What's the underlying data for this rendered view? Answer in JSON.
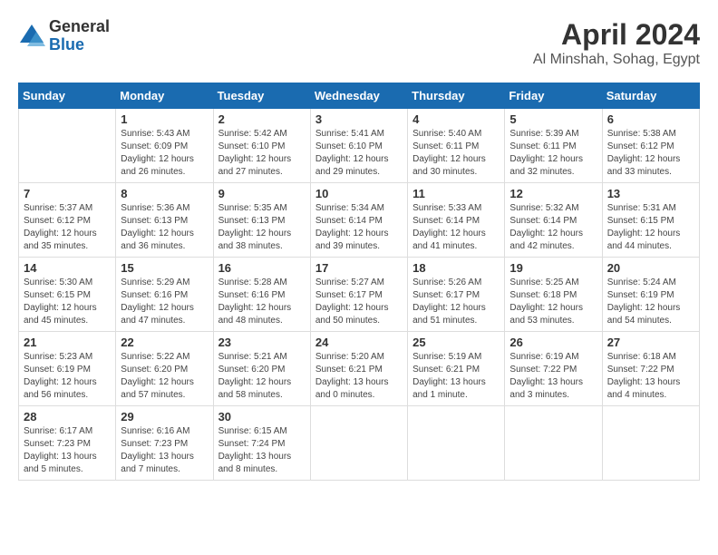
{
  "header": {
    "logo_general": "General",
    "logo_blue": "Blue",
    "month_title": "April 2024",
    "location": "Al Minshah, Sohag, Egypt"
  },
  "weekdays": [
    "Sunday",
    "Monday",
    "Tuesday",
    "Wednesday",
    "Thursday",
    "Friday",
    "Saturday"
  ],
  "weeks": [
    [
      {
        "day": "",
        "info": ""
      },
      {
        "day": "1",
        "info": "Sunrise: 5:43 AM\nSunset: 6:09 PM\nDaylight: 12 hours\nand 26 minutes."
      },
      {
        "day": "2",
        "info": "Sunrise: 5:42 AM\nSunset: 6:10 PM\nDaylight: 12 hours\nand 27 minutes."
      },
      {
        "day": "3",
        "info": "Sunrise: 5:41 AM\nSunset: 6:10 PM\nDaylight: 12 hours\nand 29 minutes."
      },
      {
        "day": "4",
        "info": "Sunrise: 5:40 AM\nSunset: 6:11 PM\nDaylight: 12 hours\nand 30 minutes."
      },
      {
        "day": "5",
        "info": "Sunrise: 5:39 AM\nSunset: 6:11 PM\nDaylight: 12 hours\nand 32 minutes."
      },
      {
        "day": "6",
        "info": "Sunrise: 5:38 AM\nSunset: 6:12 PM\nDaylight: 12 hours\nand 33 minutes."
      }
    ],
    [
      {
        "day": "7",
        "info": "Sunrise: 5:37 AM\nSunset: 6:12 PM\nDaylight: 12 hours\nand 35 minutes."
      },
      {
        "day": "8",
        "info": "Sunrise: 5:36 AM\nSunset: 6:13 PM\nDaylight: 12 hours\nand 36 minutes."
      },
      {
        "day": "9",
        "info": "Sunrise: 5:35 AM\nSunset: 6:13 PM\nDaylight: 12 hours\nand 38 minutes."
      },
      {
        "day": "10",
        "info": "Sunrise: 5:34 AM\nSunset: 6:14 PM\nDaylight: 12 hours\nand 39 minutes."
      },
      {
        "day": "11",
        "info": "Sunrise: 5:33 AM\nSunset: 6:14 PM\nDaylight: 12 hours\nand 41 minutes."
      },
      {
        "day": "12",
        "info": "Sunrise: 5:32 AM\nSunset: 6:14 PM\nDaylight: 12 hours\nand 42 minutes."
      },
      {
        "day": "13",
        "info": "Sunrise: 5:31 AM\nSunset: 6:15 PM\nDaylight: 12 hours\nand 44 minutes."
      }
    ],
    [
      {
        "day": "14",
        "info": "Sunrise: 5:30 AM\nSunset: 6:15 PM\nDaylight: 12 hours\nand 45 minutes."
      },
      {
        "day": "15",
        "info": "Sunrise: 5:29 AM\nSunset: 6:16 PM\nDaylight: 12 hours\nand 47 minutes."
      },
      {
        "day": "16",
        "info": "Sunrise: 5:28 AM\nSunset: 6:16 PM\nDaylight: 12 hours\nand 48 minutes."
      },
      {
        "day": "17",
        "info": "Sunrise: 5:27 AM\nSunset: 6:17 PM\nDaylight: 12 hours\nand 50 minutes."
      },
      {
        "day": "18",
        "info": "Sunrise: 5:26 AM\nSunset: 6:17 PM\nDaylight: 12 hours\nand 51 minutes."
      },
      {
        "day": "19",
        "info": "Sunrise: 5:25 AM\nSunset: 6:18 PM\nDaylight: 12 hours\nand 53 minutes."
      },
      {
        "day": "20",
        "info": "Sunrise: 5:24 AM\nSunset: 6:19 PM\nDaylight: 12 hours\nand 54 minutes."
      }
    ],
    [
      {
        "day": "21",
        "info": "Sunrise: 5:23 AM\nSunset: 6:19 PM\nDaylight: 12 hours\nand 56 minutes."
      },
      {
        "day": "22",
        "info": "Sunrise: 5:22 AM\nSunset: 6:20 PM\nDaylight: 12 hours\nand 57 minutes."
      },
      {
        "day": "23",
        "info": "Sunrise: 5:21 AM\nSunset: 6:20 PM\nDaylight: 12 hours\nand 58 minutes."
      },
      {
        "day": "24",
        "info": "Sunrise: 5:20 AM\nSunset: 6:21 PM\nDaylight: 13 hours\nand 0 minutes."
      },
      {
        "day": "25",
        "info": "Sunrise: 5:19 AM\nSunset: 6:21 PM\nDaylight: 13 hours\nand 1 minute."
      },
      {
        "day": "26",
        "info": "Sunrise: 6:19 AM\nSunset: 7:22 PM\nDaylight: 13 hours\nand 3 minutes."
      },
      {
        "day": "27",
        "info": "Sunrise: 6:18 AM\nSunset: 7:22 PM\nDaylight: 13 hours\nand 4 minutes."
      }
    ],
    [
      {
        "day": "28",
        "info": "Sunrise: 6:17 AM\nSunset: 7:23 PM\nDaylight: 13 hours\nand 5 minutes."
      },
      {
        "day": "29",
        "info": "Sunrise: 6:16 AM\nSunset: 7:23 PM\nDaylight: 13 hours\nand 7 minutes."
      },
      {
        "day": "30",
        "info": "Sunrise: 6:15 AM\nSunset: 7:24 PM\nDaylight: 13 hours\nand 8 minutes."
      },
      {
        "day": "",
        "info": ""
      },
      {
        "day": "",
        "info": ""
      },
      {
        "day": "",
        "info": ""
      },
      {
        "day": "",
        "info": ""
      }
    ]
  ]
}
